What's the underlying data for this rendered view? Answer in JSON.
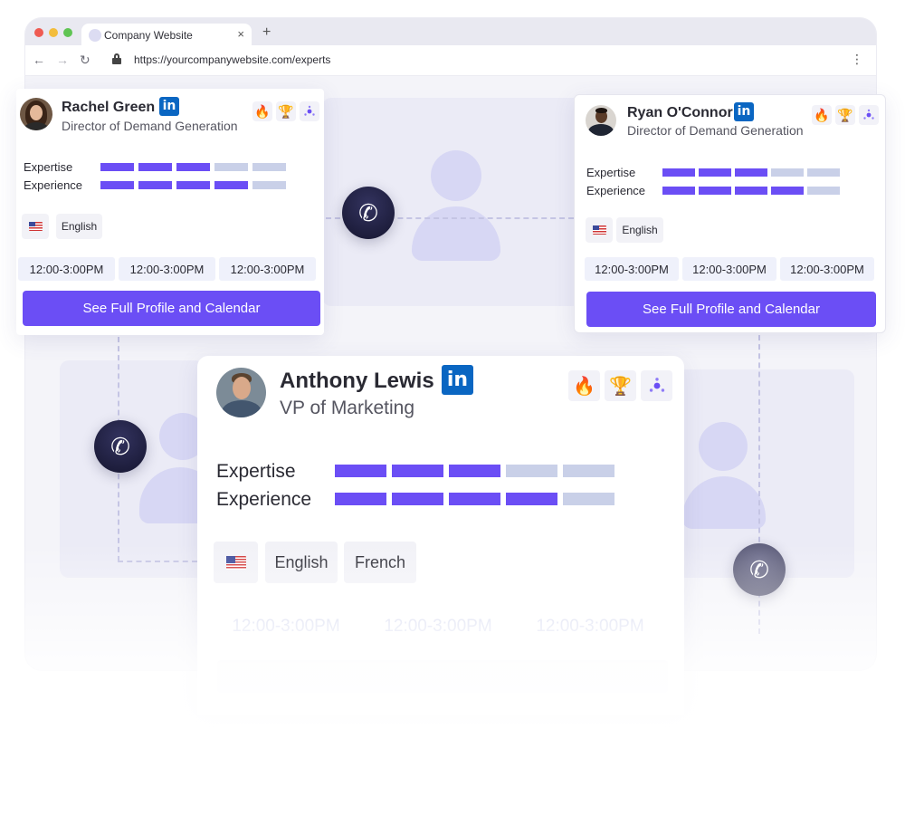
{
  "browser": {
    "tab_title": "Company Website",
    "tab_close": "×",
    "new_tab": "+",
    "url": "https://yourcompanywebsite.com/experts",
    "nav_back": "←",
    "nav_forward": "→",
    "nav_reload": "↻",
    "menu": "⋮"
  },
  "icons": {
    "phone": "✆",
    "flame": "🔥",
    "trophy": "🏆",
    "linkedin": "in"
  },
  "experts": [
    {
      "name": "Rachel Green",
      "role": "Director of Demand Generation",
      "metrics": [
        {
          "label": "Expertise",
          "level": 3,
          "max": 5
        },
        {
          "label": "Experience",
          "level": 4,
          "max": 5
        }
      ],
      "languages": [
        "English"
      ],
      "slots": [
        "12:00-3:00PM",
        "12:00-3:00PM",
        "12:00-3:00PM"
      ],
      "cta": "See Full Profile and Calendar"
    },
    {
      "name": "Ryan O'Connor",
      "role": "Director of Demand Generation",
      "metrics": [
        {
          "label": "Expertise",
          "level": 3,
          "max": 5
        },
        {
          "label": "Experience",
          "level": 4,
          "max": 5
        }
      ],
      "languages": [
        "English"
      ],
      "slots": [
        "12:00-3:00PM",
        "12:00-3:00PM",
        "12:00-3:00PM"
      ],
      "cta": "See Full Profile and Calendar"
    },
    {
      "name": "Anthony Lewis",
      "role": "VP of Marketing",
      "metrics": [
        {
          "label": "Expertise",
          "level": 3,
          "max": 5
        },
        {
          "label": "Experience",
          "level": 4,
          "max": 5
        }
      ],
      "languages": [
        "English",
        "French"
      ],
      "slots": [
        "12:00-3:00PM",
        "12:00-3:00PM",
        "12:00-3:00PM"
      ]
    }
  ],
  "colors": {
    "accent": "#6b4ef5",
    "bar_off": "#c9d0e8",
    "linkedin": "#0a66c2"
  }
}
